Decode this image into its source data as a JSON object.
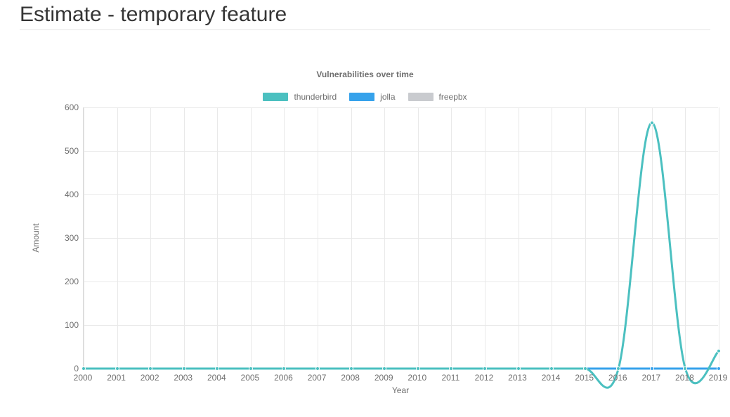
{
  "page_title": "Estimate - temporary feature",
  "chart_data": {
    "type": "line",
    "title": "Vulnerabilities over time",
    "xlabel": "Year",
    "ylabel": "Amount",
    "xlim": [
      2000,
      2019
    ],
    "ylim": [
      0,
      600
    ],
    "yticks": [
      0,
      100,
      200,
      300,
      400,
      500,
      600
    ],
    "categories": [
      2000,
      2001,
      2002,
      2003,
      2004,
      2005,
      2006,
      2007,
      2008,
      2009,
      2010,
      2011,
      2012,
      2013,
      2014,
      2015,
      2016,
      2017,
      2018,
      2019
    ],
    "series": [
      {
        "name": "thunderbird",
        "color": "#4bc0c0",
        "values": [
          0,
          0,
          0,
          0,
          0,
          0,
          0,
          0,
          0,
          0,
          0,
          0,
          0,
          0,
          0,
          0,
          0,
          565,
          0,
          40
        ]
      },
      {
        "name": "jolla",
        "color": "#36a2eb",
        "values": [
          0,
          0,
          0,
          0,
          0,
          0,
          0,
          0,
          0,
          0,
          0,
          0,
          0,
          0,
          0,
          0,
          0,
          0,
          0,
          0
        ]
      },
      {
        "name": "freepbx",
        "color": "#c9cbcf",
        "values": [
          0,
          0,
          0,
          0,
          0,
          0,
          0,
          0,
          0,
          0,
          0,
          0,
          0,
          0,
          0,
          0,
          0,
          0,
          0,
          0
        ]
      }
    ]
  }
}
